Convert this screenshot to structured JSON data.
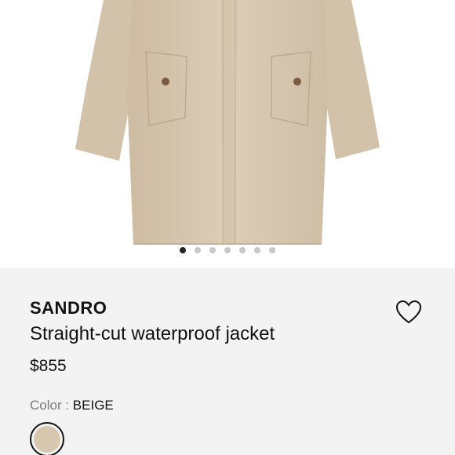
{
  "product": {
    "brand": "SANDRO",
    "name": "Straight-cut waterproof jacket",
    "price": "$855",
    "color_label": "Color : ",
    "color_value": "BEIGE",
    "swatch_color": "#d8c8b0"
  },
  "gallery": {
    "image_alt": "beige-coat-product-image",
    "dot_count": 7,
    "active_index": 0
  },
  "icons": {
    "wishlist": "heart-icon"
  },
  "colors": {
    "info_background": "#f3f3f3",
    "coat": "#d9c8b1",
    "dot_active": "#222222",
    "dot_inactive": "#c8c8c8"
  }
}
